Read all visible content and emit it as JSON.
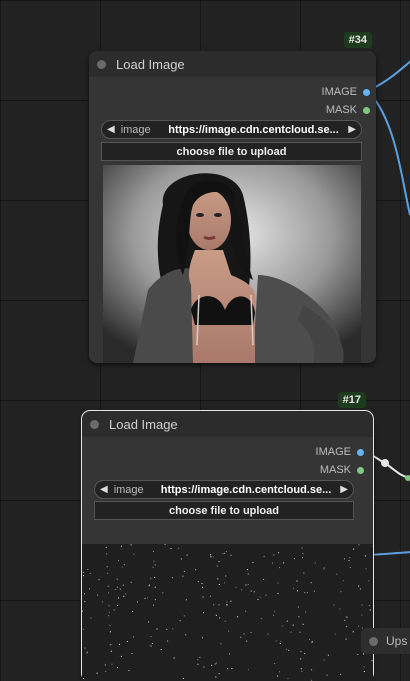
{
  "nodes": [
    {
      "id_badge": "#34",
      "title": "Load Image",
      "outputs": [
        {
          "label": "IMAGE",
          "color": "#64b5f6"
        },
        {
          "label": "MASK",
          "color": "#81c784"
        }
      ],
      "image_widget": {
        "label": "image",
        "value": "https://image.cdn.centcloud.se..."
      },
      "upload_label": "choose file to upload",
      "preview": "portrait-photo"
    },
    {
      "id_badge": "#17",
      "title": "Load Image",
      "outputs": [
        {
          "label": "IMAGE",
          "color": "#64b5f6"
        },
        {
          "label": "MASK",
          "color": "#81c784"
        }
      ],
      "image_widget": {
        "label": "image",
        "value": "https://image.cdn.centcloud.se..."
      },
      "upload_label": "choose file to upload",
      "preview": "noise-texture"
    }
  ],
  "partial_node": {
    "title": "Ups"
  },
  "colors": {
    "canvas": "#222222",
    "node": "#353535",
    "image_link": "#64b5f6",
    "mask_link": "#81c784"
  }
}
